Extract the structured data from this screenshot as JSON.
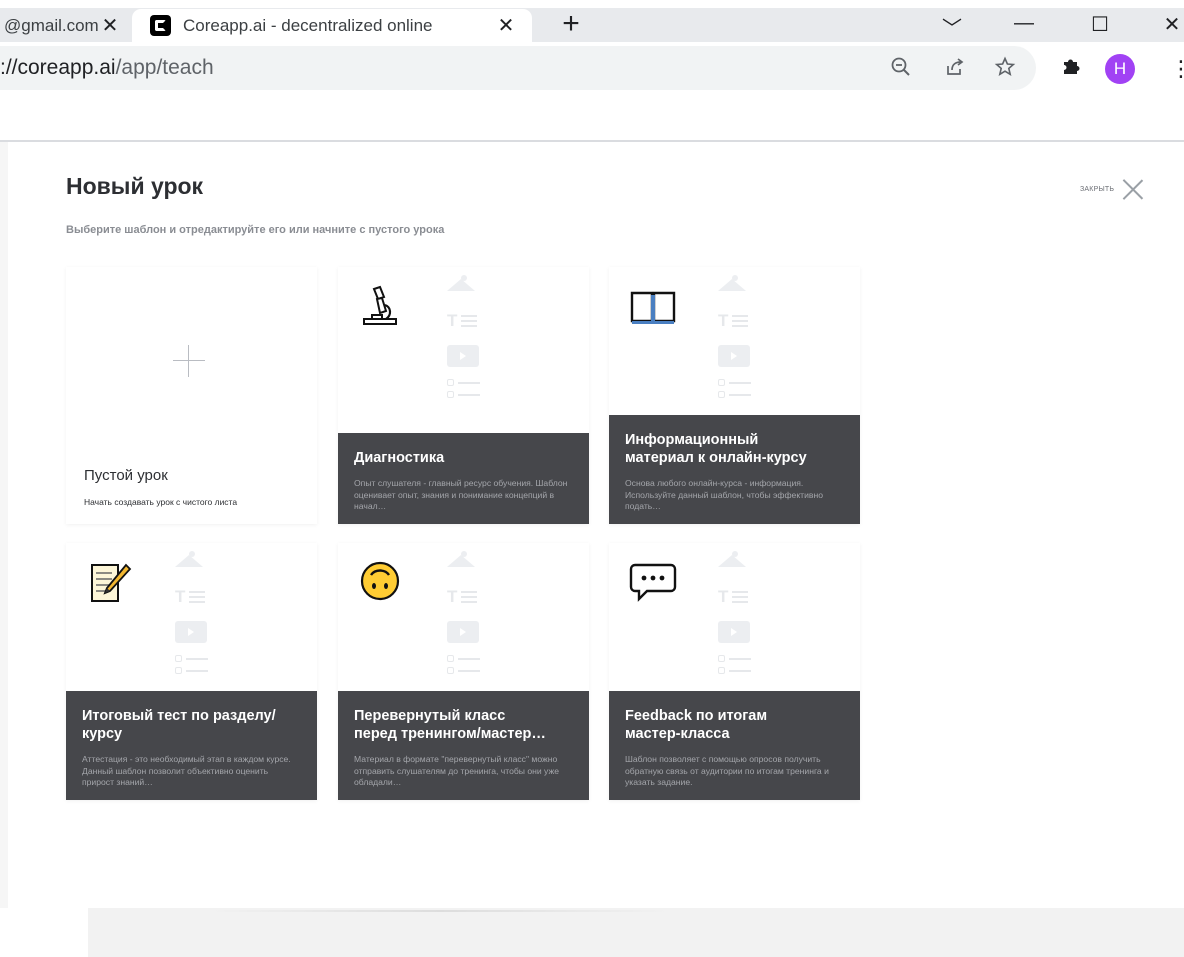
{
  "browser": {
    "tabs": [
      {
        "title": "@gmail.com",
        "close": "✕"
      },
      {
        "title": "Coreapp.ai - decentralized online",
        "close": "✕"
      }
    ],
    "new_tab": "+",
    "window_controls": {
      "minimize": "—",
      "maximize": "☐",
      "close": "✕",
      "tab_search": "﹀"
    },
    "url_host": "://coreapp.ai",
    "url_path": "/app/teach",
    "profile_initial": "H",
    "profile_color": "#a142f4"
  },
  "page": {
    "title": "Новый урок",
    "subtitle": "Выберите шаблон и отредактируйте его или начните с пустого урока",
    "close_label": "ЗАКРЫТЬ",
    "blank_card": {
      "title": "Пустой урок",
      "subtitle": "Начать создавать урок с чистого листа"
    },
    "templates": [
      {
        "icon": "microscope-icon",
        "title": "Диагностика",
        "desc": "Опыт слушателя - главный ресурс обучения. Шаблон оценивает опыт, знания и понимание концепций в начал…"
      },
      {
        "icon": "book-icon",
        "title_line1": "Информационный",
        "title_line2": "материал к онлайн-курсу",
        "desc": "Основа любого онлайн-курса - информация. Используйте данный шаблон, чтобы эффективно подать…"
      },
      {
        "icon": "memo-icon",
        "title_line1": "Итоговый тест по разделу/",
        "title_line2": "курсу",
        "desc": "Аттестация - это необходимый этап в каждом курсе. Данный шаблон позволит объективно оценить прирост знаний…"
      },
      {
        "icon": "upside-down-face-icon",
        "title_line1": "Перевернутый класс",
        "title_line2": "перед тренингом/мастер…",
        "desc": "Материал в формате \"перевернутый класс\" можно отправить слушателям до тренинга, чтобы они уже обладали…"
      },
      {
        "icon": "speech-bubble-icon",
        "title_line1": "Feedback по итогам",
        "title_line2": "мастер-класса",
        "desc": "Шаблон позволяет с помощью опросов получить обратную связь от аудитории по итогам тренинга и указать задание."
      }
    ],
    "colors": {
      "card_overlay": "#46474b",
      "title": "#2d2f33",
      "subtitle": "#8a8d93"
    }
  }
}
